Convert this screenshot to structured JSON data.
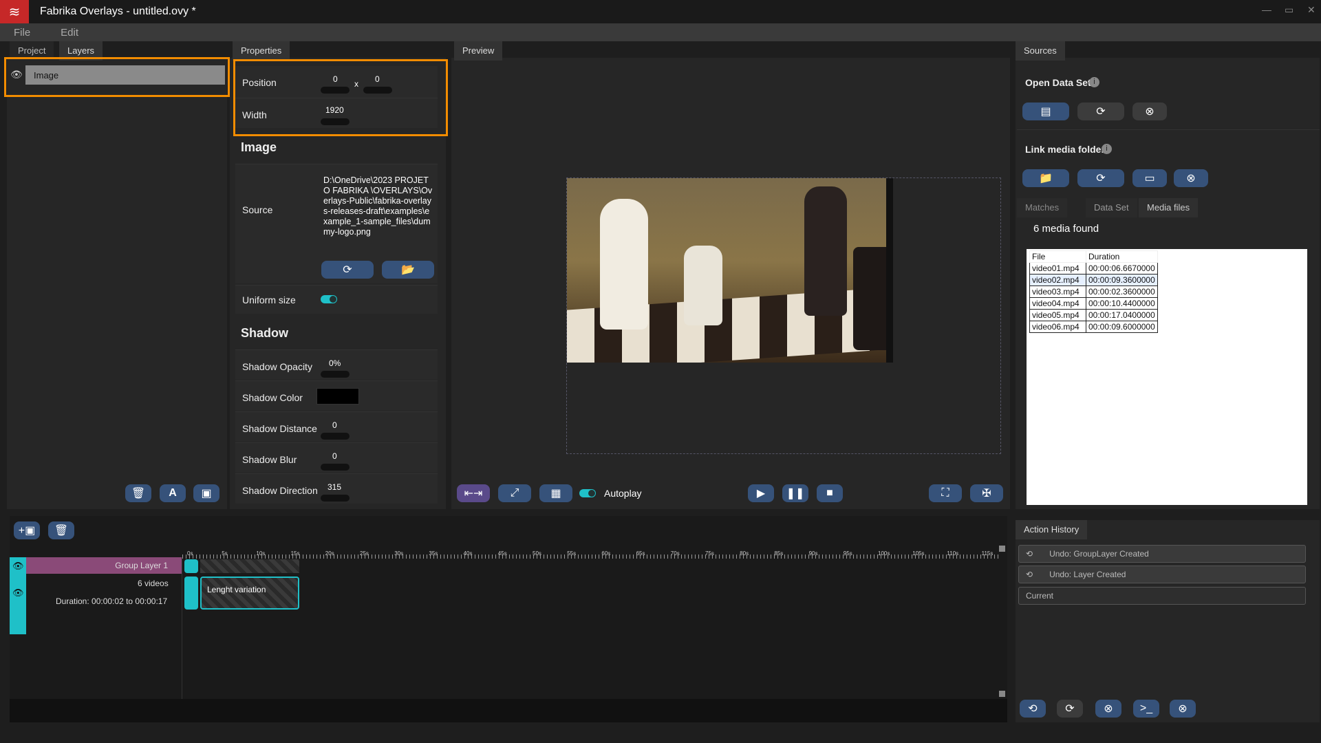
{
  "window": {
    "title": "Fabrika Overlays - untitled.ovy *",
    "min": "—",
    "max": "▭",
    "close": "✕"
  },
  "menu": {
    "file": "File",
    "edit": "Edit"
  },
  "left": {
    "tab_project": "Project",
    "tab_layers": "Layers",
    "layer_name": "Image"
  },
  "props": {
    "tab": "Properties",
    "position_label": "Position",
    "pos_x": "0",
    "pos_sep": "x",
    "pos_y": "0",
    "width_label": "Width",
    "width_value": "1920",
    "image_heading": "Image",
    "source_label": "Source",
    "source_value": "D:\\OneDrive\\2023 PROJETO FABRIKA \\OVERLAYS\\Overlays-Public\\fabrika-overlays-releases-draft\\examples\\example_1-sample_files\\dummy-logo.png",
    "uniform_label": "Uniform size",
    "shadow_heading": "Shadow",
    "opacity_label": "Shadow Opacity",
    "opacity_value": "0%",
    "color_label": "Shadow Color",
    "color_value": "#000000",
    "distance_label": "Shadow Distance",
    "distance_value": "0",
    "blur_label": "Shadow Blur",
    "blur_value": "0",
    "direction_label": "Shadow Direction",
    "direction_value": "315"
  },
  "preview": {
    "tab": "Preview",
    "autoplay": "Autoplay"
  },
  "sources": {
    "tab": "Sources",
    "open_data_set": "Open Data Set",
    "link_media": "Link media folder",
    "tab_matches": "Matches",
    "tab_dataset": "Data Set",
    "tab_media": "Media files",
    "media_found": "6 media found",
    "col_file": "File",
    "col_duration": "Duration",
    "rows": [
      [
        "video01.mp4",
        "00:00:06.6670000"
      ],
      [
        "video02.mp4",
        "00:00:09.3600000"
      ],
      [
        "video03.mp4",
        "00:00:02.3600000"
      ],
      [
        "video04.mp4",
        "00:00:10.4400000"
      ],
      [
        "video05.mp4",
        "00:00:17.0400000"
      ],
      [
        "video06.mp4",
        "00:00:09.6000000"
      ]
    ]
  },
  "history": {
    "tab": "Action History",
    "items": [
      "Undo: GroupLayer Created",
      "Undo: Layer Created",
      "Current"
    ]
  },
  "timeline": {
    "group_label": "Group Layer 1",
    "videos": "6 videos",
    "duration": "Duration: 00:00:02 to 00:00:17",
    "clip": "Lenght variation",
    "ticks": [
      "0s",
      "5s",
      "10s",
      "15s",
      "20s",
      "25s",
      "30s",
      "35s",
      "40s",
      "45s",
      "50s",
      "55s",
      "60s",
      "65s",
      "70s",
      "75s",
      "80s",
      "85s",
      "90s",
      "95s",
      "100s",
      "105s",
      "110s",
      "115s"
    ]
  },
  "colors": {
    "accent": "#f28c00",
    "teal": "#1fc0c8",
    "button_blue": "#36527a"
  }
}
